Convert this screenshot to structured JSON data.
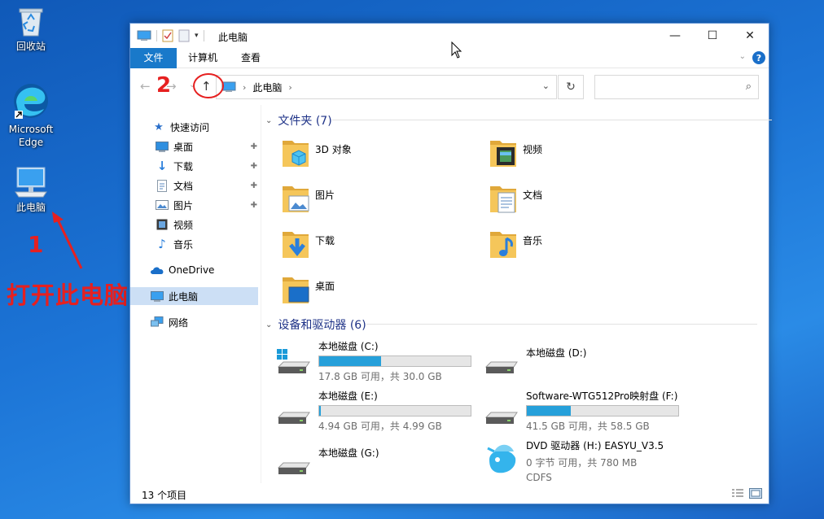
{
  "desktop": {
    "icons": [
      {
        "label": "回收站",
        "icon": "recycle-bin-icon"
      },
      {
        "label": "Microsoft Edge",
        "icon": "edge-icon"
      },
      {
        "label": "此电脑",
        "icon": "this-pc-icon"
      }
    ],
    "annotations": {
      "step1": "1",
      "step1_text": "打开此电脑",
      "step2": "2",
      "color": "#e62020"
    }
  },
  "window": {
    "title": "此电脑",
    "controls": {
      "minimize": "—",
      "maximize": "☐",
      "close": "✕"
    },
    "ribbon_tabs": [
      "文件",
      "计算机",
      "查看"
    ],
    "nav": {
      "back": "←",
      "forward": "→",
      "recent": "⌄",
      "up": "↑"
    },
    "address": {
      "crumb": "此电脑",
      "sep": "›",
      "chevron": "⌄"
    },
    "refresh": "↻",
    "search_placeholder": "",
    "search_icon": "⌕"
  },
  "sidebar": {
    "quick_access": "快速访问",
    "quick_items": [
      {
        "label": "桌面",
        "icon": "desktop-icon",
        "pinned": true
      },
      {
        "label": "下载",
        "icon": "download-icon",
        "pinned": true
      },
      {
        "label": "文档",
        "icon": "document-icon",
        "pinned": true
      },
      {
        "label": "图片",
        "icon": "picture-icon",
        "pinned": true
      },
      {
        "label": "视频",
        "icon": "video-icon",
        "pinned": false
      },
      {
        "label": "音乐",
        "icon": "music-icon",
        "pinned": false
      }
    ],
    "onedrive": "OneDrive",
    "this_pc": "此电脑",
    "network": "网络",
    "pin_glyph": "📌"
  },
  "content": {
    "folders_header": "文件夹 (7)",
    "folders": [
      {
        "label": "3D 对象",
        "icon": "3d-objects-icon"
      },
      {
        "label": "视频",
        "icon": "video-icon"
      },
      {
        "label": "图片",
        "icon": "picture-icon"
      },
      {
        "label": "文档",
        "icon": "document-icon"
      },
      {
        "label": "下载",
        "icon": "download-icon"
      },
      {
        "label": "音乐",
        "icon": "music-icon"
      },
      {
        "label": "桌面",
        "icon": "desktop-icon"
      }
    ],
    "devices_header": "设备和驱动器 (6)",
    "drives": [
      {
        "name": "本地磁盘 (C:)",
        "free": "17.8 GB 可用，共 30.0 GB",
        "used_fraction": 0.41,
        "icon": "windows-drive-icon"
      },
      {
        "name": "本地磁盘 (D:)",
        "free": "",
        "used_fraction": null,
        "icon": "hdd-icon"
      },
      {
        "name": "本地磁盘 (E:)",
        "free": "4.94 GB 可用，共 4.99 GB",
        "used_fraction": 0.01,
        "icon": "hdd-icon"
      },
      {
        "name": "Software-WTG512Pro映射盘 (F:)",
        "free": "41.5 GB 可用，共 58.5 GB",
        "used_fraction": 0.29,
        "icon": "hdd-icon"
      },
      {
        "name": "本地磁盘 (G:)",
        "free": "",
        "used_fraction": null,
        "icon": "hdd-icon"
      },
      {
        "name": "DVD 驱动器 (H:) EASYU_V3.5",
        "free": "0 字节 可用，共 780 MB",
        "extra": "CDFS",
        "used_fraction": null,
        "icon": "dvd-drive-icon"
      }
    ]
  },
  "status": {
    "count": "13 个项目"
  },
  "colors": {
    "accent": "#1979ca",
    "bar": "#26a0da",
    "folder": "#f5c65a",
    "selected": "#ccdff5",
    "annotation": "#e62020"
  }
}
